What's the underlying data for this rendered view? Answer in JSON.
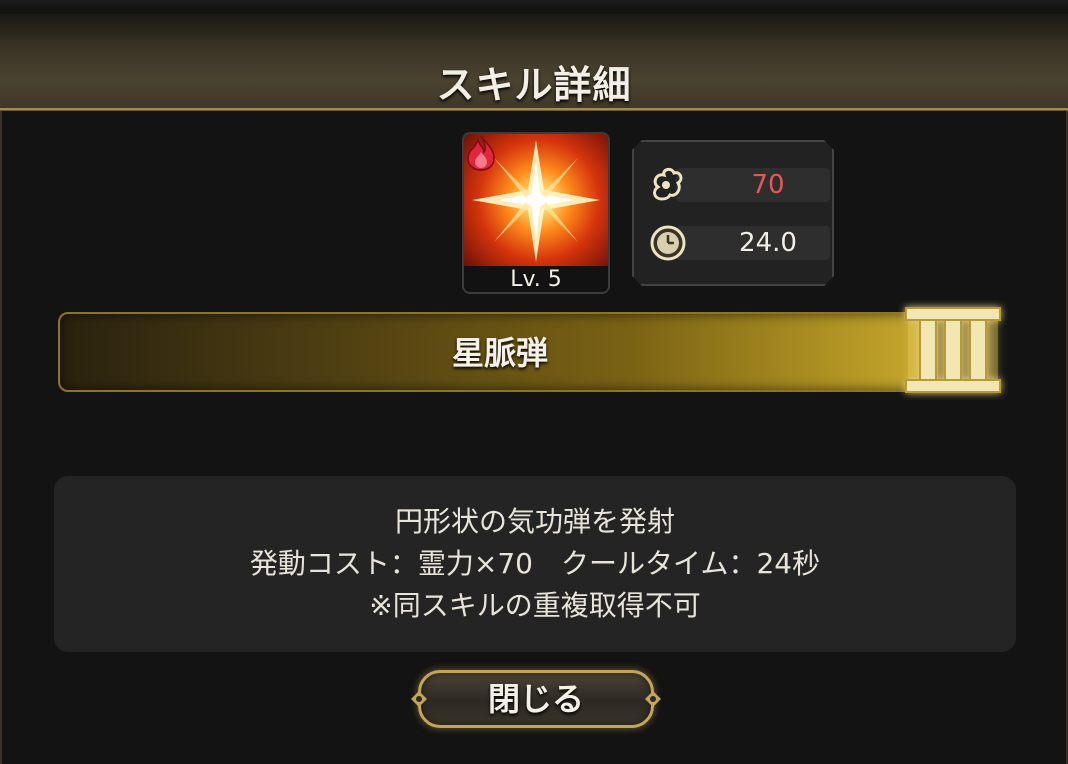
{
  "header": {
    "title": "スキル詳細"
  },
  "skill": {
    "name": "星脈弾",
    "level_label": "Lv. 5",
    "element_icon": "fire-element-icon",
    "rank": "III"
  },
  "stats": {
    "cost_icon": "spirit-cost-icon",
    "cost_value": "70",
    "cooldown_icon": "clock-icon",
    "cooldown_value": "24.0"
  },
  "description": {
    "line1": "円形状の気功弾を発射",
    "line2": "発動コスト：霊力×70　クールタイム：24秒",
    "line3": "※同スキルの重複取得不可"
  },
  "close_button": {
    "label": "閉じる"
  },
  "colors": {
    "accent_gold": "#c4a55c",
    "cost_red": "#e05a55",
    "banner_gold": "#c9ab30"
  }
}
